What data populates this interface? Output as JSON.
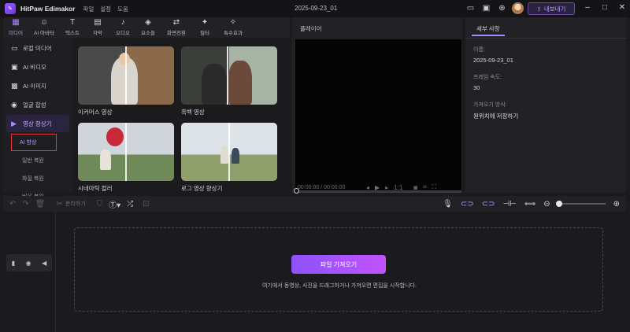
{
  "app": {
    "name": "HitPaw Edimakor",
    "menu": [
      "파일",
      "설정",
      "도움"
    ],
    "project_title": "2025-09-23_01",
    "export_label": "내보내기"
  },
  "media_toolbar": {
    "items": [
      {
        "label": "미디어",
        "icon": "media-icon"
      },
      {
        "label": "AI 아바타",
        "icon": "avatar-icon"
      },
      {
        "label": "텍스트",
        "icon": "text-icon"
      },
      {
        "label": "자막",
        "icon": "subtitle-icon"
      },
      {
        "label": "오디오",
        "icon": "audio-icon"
      },
      {
        "label": "요소들",
        "icon": "elements-icon"
      },
      {
        "label": "화면전환",
        "icon": "transition-icon"
      },
      {
        "label": "필터",
        "icon": "filter-icon"
      },
      {
        "label": "특수효과",
        "icon": "effects-icon"
      }
    ]
  },
  "left_nav": {
    "items": [
      {
        "label": "로컬 미디어",
        "icon": "folder-icon"
      },
      {
        "label": "AI 비디오",
        "icon": "ai-video-icon"
      },
      {
        "label": "AI 이미지",
        "icon": "ai-image-icon"
      },
      {
        "label": "얼굴 합성",
        "icon": "face-swap-icon"
      },
      {
        "label": "영상 향상기",
        "icon": "enhancer-icon"
      }
    ],
    "sub_items": [
      "AI 향상",
      "일반 복원",
      "화질 복원",
      "비율 복원"
    ]
  },
  "media_cards": [
    {
      "label": "이커머스 영상"
    },
    {
      "label": "흑백 영상"
    },
    {
      "label": "시네마틱 컬러"
    },
    {
      "label": "로그 영상 향상기"
    }
  ],
  "player": {
    "title": "플레이어",
    "time": "00:00:00 / 00:00:00",
    "speed": "1:1"
  },
  "details": {
    "tab": "세부 사항",
    "fields": [
      {
        "label": "이름:",
        "value": "2025-09-23_01"
      },
      {
        "label": "프레임 속도:",
        "value": "30"
      },
      {
        "label": "가져오기 방식:",
        "value": "원위치에 저장하기"
      }
    ]
  },
  "timeline": {
    "split_label": "분리하기",
    "import_label": "파일 가져오기",
    "drop_hint": "여기에서 동영상, 사진을 드래그하거나 가져오면 편집을 시작합니다."
  },
  "colors": {
    "accent": "#a98bff",
    "highlight_box": "#e23b3b",
    "import_gradient_start": "#8f52ff",
    "import_gradient_end": "#c053ff"
  }
}
